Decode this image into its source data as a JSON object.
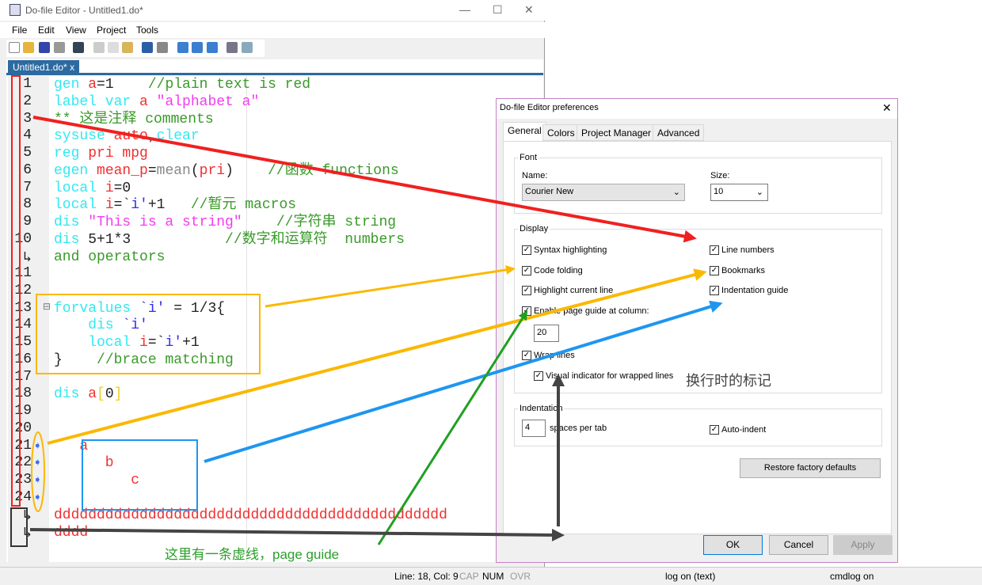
{
  "window": {
    "title": "Do-file Editor - Untitled1.do*",
    "minimize": "—",
    "maximize": "☐",
    "close": "✕"
  },
  "menu": [
    "File",
    "Edit",
    "View",
    "Project",
    "Tools"
  ],
  "tab": {
    "label": "Untitled1.do*",
    "close": "x"
  },
  "colors": {
    "c": "#33e8f0",
    "r": "#f03030",
    "g": "#3a9a2a",
    "m": "#f23cf0",
    "b": "#3030f0",
    "k": "#222222",
    "y": "#e8d020",
    "s": "#888888"
  },
  "gutter": [
    "1",
    "2",
    "3",
    "4",
    "5",
    "6",
    "7",
    "8",
    "9",
    "10",
    "↳",
    "11",
    "12",
    "13",
    "14",
    "15",
    "16",
    "17",
    "18",
    "19",
    "20",
    "21",
    "22",
    "23",
    "24",
    "↳",
    "↳"
  ],
  "code": [
    [
      [
        "gen ",
        "c"
      ],
      [
        "a",
        "r"
      ],
      [
        "=1    ",
        "k"
      ],
      [
        "//plain text is red",
        "g"
      ]
    ],
    [
      [
        "label var ",
        "c"
      ],
      [
        "a ",
        "r"
      ],
      [
        "\"alphabet a\"",
        "m"
      ]
    ],
    [
      [
        "** 这是注释 comments",
        "g"
      ]
    ],
    [
      [
        "sysuse ",
        "c"
      ],
      [
        "auto",
        "r"
      ],
      [
        ",",
        "k"
      ],
      [
        "clear",
        "c"
      ]
    ],
    [
      [
        "reg ",
        "c"
      ],
      [
        "pri mpg",
        "r"
      ]
    ],
    [
      [
        "egen ",
        "c"
      ],
      [
        "mean_p",
        "r"
      ],
      [
        "=",
        "k"
      ],
      [
        "mean",
        "s"
      ],
      [
        "(",
        "k"
      ],
      [
        "pri",
        "r"
      ],
      [
        ")    ",
        "k"
      ],
      [
        "//函数 functions",
        "g"
      ]
    ],
    [
      [
        "local ",
        "c"
      ],
      [
        "i",
        "r"
      ],
      [
        "=0",
        "k"
      ]
    ],
    [
      [
        "local ",
        "c"
      ],
      [
        "i",
        "r"
      ],
      [
        "=`",
        "k"
      ],
      [
        "i'",
        "b"
      ],
      [
        "+1   ",
        "k"
      ],
      [
        "//暂元 macros",
        "g"
      ]
    ],
    [
      [
        "dis ",
        "c"
      ],
      [
        "\"This is a string\"",
        "m"
      ],
      [
        "    //字符串 string",
        "g"
      ]
    ],
    [
      [
        "dis ",
        "c"
      ],
      [
        "5+1*3",
        "k"
      ],
      [
        "           //数字和运算符  numbers",
        "g"
      ]
    ],
    [
      [
        "and operators",
        "g"
      ]
    ],
    [],
    [],
    [
      [
        "forvalues ",
        "c"
      ],
      [
        "`i'",
        "b"
      ],
      [
        " = 1/3{",
        "k"
      ]
    ],
    [
      [
        "    dis ",
        "c"
      ],
      [
        "`i'",
        "b"
      ]
    ],
    [
      [
        "    local ",
        "c"
      ],
      [
        "i",
        "r"
      ],
      [
        "=`",
        "k"
      ],
      [
        "i'",
        "b"
      ],
      [
        "+1",
        "k"
      ]
    ],
    [
      [
        "}    ",
        "k"
      ],
      [
        "//brace matching",
        "g"
      ]
    ],
    [],
    [
      [
        "dis ",
        "c"
      ],
      [
        "a",
        "r"
      ],
      [
        "[",
        "y"
      ],
      [
        "0",
        "k"
      ],
      [
        "]",
        "y"
      ]
    ],
    [],
    [],
    [
      [
        "   a",
        "r"
      ]
    ],
    [
      [
        "      b",
        "r"
      ]
    ],
    [
      [
        "         c",
        "r"
      ]
    ],
    [],
    [
      [
        "dddddddddddddddddddddddddddddddddddddddddddddd",
        "r"
      ]
    ],
    [
      [
        "dddd",
        "r"
      ]
    ]
  ],
  "annotations": {
    "wrap_marker": "换行时的标记",
    "page_guide": "这里有一条虚线，page guide"
  },
  "status": {
    "position": "Line: 18, Col: 9",
    "cap": "CAP",
    "num": "NUM",
    "ovr": "OVR",
    "log": "log on (text)",
    "cmdlog": "cmdlog on"
  },
  "dialog": {
    "title": "Do-file Editor preferences",
    "close": "✕",
    "tabs": [
      "General",
      "Colors",
      "Project Manager",
      "Advanced"
    ],
    "font": {
      "group": "Font",
      "name_label": "Name:",
      "name_value": "Courier New",
      "size_label": "Size:",
      "size_value": "10"
    },
    "display": {
      "group": "Display",
      "syntax": "Syntax highlighting",
      "folding": "Code folding",
      "highlight": "Highlight current line",
      "page_guide": "Enable page guide at column:",
      "page_guide_col": "20",
      "wrap": "Wrap lines",
      "visual": "Visual indicator for wrapped lines",
      "line_numbers": "Line numbers",
      "bookmarks": "Bookmarks",
      "indent_guide": "Indentation guide"
    },
    "indentation": {
      "group": "Indentation",
      "spaces": "4",
      "spaces_label": "spaces per tab",
      "auto": "Auto-indent"
    },
    "restore": "Restore factory defaults",
    "ok": "OK",
    "cancel": "Cancel",
    "apply": "Apply"
  }
}
